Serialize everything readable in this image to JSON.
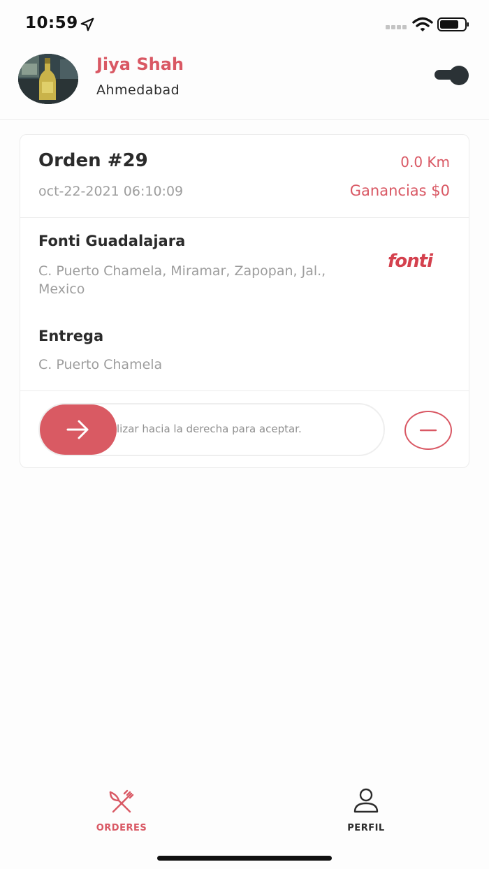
{
  "status_bar": {
    "time": "10:59"
  },
  "header": {
    "user_name": "Jiya Shah",
    "user_city": "Ahmedabad"
  },
  "order": {
    "title": "Orden #29",
    "distance": "0.0 Km",
    "date": "oct-22-2021 06:10:09",
    "earnings": "Ganancias $0",
    "store_name": "Fonti Guadalajara",
    "store_address": "C. Puerto Chamela, Miramar, Zapopan, Jal., Mexico",
    "store_logo": "fonti",
    "delivery_label": "Entrega",
    "delivery_address": "C. Puerto Chamela",
    "slider_text": "lizar hacia la derecha para aceptar."
  },
  "tabs": {
    "orders_label": "ORDERES",
    "profile_label": "PERFIL"
  },
  "colors": {
    "accent": "#d95864",
    "text": "#2b2b2b",
    "muted": "#9d9d9d"
  },
  "icons": [
    "location-arrow-icon",
    "signal-icon",
    "wifi-icon",
    "battery-icon",
    "toggle-switch",
    "arrow-right-icon",
    "minus-circle-icon",
    "fork-knife-icon",
    "user-icon"
  ]
}
